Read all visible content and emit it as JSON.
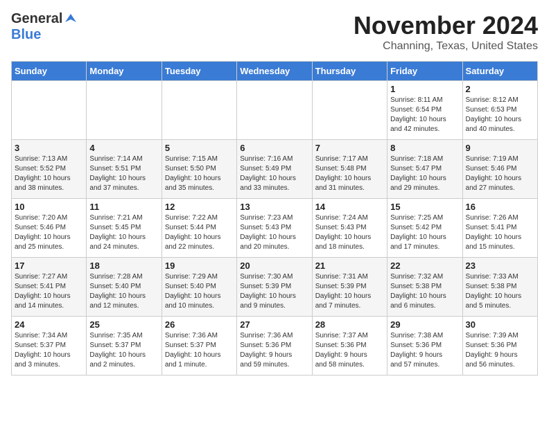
{
  "header": {
    "logo_general": "General",
    "logo_blue": "Blue",
    "month": "November 2024",
    "location": "Channing, Texas, United States"
  },
  "weekdays": [
    "Sunday",
    "Monday",
    "Tuesday",
    "Wednesday",
    "Thursday",
    "Friday",
    "Saturday"
  ],
  "weeks": [
    [
      {
        "day": "",
        "info": ""
      },
      {
        "day": "",
        "info": ""
      },
      {
        "day": "",
        "info": ""
      },
      {
        "day": "",
        "info": ""
      },
      {
        "day": "",
        "info": ""
      },
      {
        "day": "1",
        "info": "Sunrise: 8:11 AM\nSunset: 6:54 PM\nDaylight: 10 hours\nand 42 minutes."
      },
      {
        "day": "2",
        "info": "Sunrise: 8:12 AM\nSunset: 6:53 PM\nDaylight: 10 hours\nand 40 minutes."
      }
    ],
    [
      {
        "day": "3",
        "info": "Sunrise: 7:13 AM\nSunset: 5:52 PM\nDaylight: 10 hours\nand 38 minutes."
      },
      {
        "day": "4",
        "info": "Sunrise: 7:14 AM\nSunset: 5:51 PM\nDaylight: 10 hours\nand 37 minutes."
      },
      {
        "day": "5",
        "info": "Sunrise: 7:15 AM\nSunset: 5:50 PM\nDaylight: 10 hours\nand 35 minutes."
      },
      {
        "day": "6",
        "info": "Sunrise: 7:16 AM\nSunset: 5:49 PM\nDaylight: 10 hours\nand 33 minutes."
      },
      {
        "day": "7",
        "info": "Sunrise: 7:17 AM\nSunset: 5:48 PM\nDaylight: 10 hours\nand 31 minutes."
      },
      {
        "day": "8",
        "info": "Sunrise: 7:18 AM\nSunset: 5:47 PM\nDaylight: 10 hours\nand 29 minutes."
      },
      {
        "day": "9",
        "info": "Sunrise: 7:19 AM\nSunset: 5:46 PM\nDaylight: 10 hours\nand 27 minutes."
      }
    ],
    [
      {
        "day": "10",
        "info": "Sunrise: 7:20 AM\nSunset: 5:46 PM\nDaylight: 10 hours\nand 25 minutes."
      },
      {
        "day": "11",
        "info": "Sunrise: 7:21 AM\nSunset: 5:45 PM\nDaylight: 10 hours\nand 24 minutes."
      },
      {
        "day": "12",
        "info": "Sunrise: 7:22 AM\nSunset: 5:44 PM\nDaylight: 10 hours\nand 22 minutes."
      },
      {
        "day": "13",
        "info": "Sunrise: 7:23 AM\nSunset: 5:43 PM\nDaylight: 10 hours\nand 20 minutes."
      },
      {
        "day": "14",
        "info": "Sunrise: 7:24 AM\nSunset: 5:43 PM\nDaylight: 10 hours\nand 18 minutes."
      },
      {
        "day": "15",
        "info": "Sunrise: 7:25 AM\nSunset: 5:42 PM\nDaylight: 10 hours\nand 17 minutes."
      },
      {
        "day": "16",
        "info": "Sunrise: 7:26 AM\nSunset: 5:41 PM\nDaylight: 10 hours\nand 15 minutes."
      }
    ],
    [
      {
        "day": "17",
        "info": "Sunrise: 7:27 AM\nSunset: 5:41 PM\nDaylight: 10 hours\nand 14 minutes."
      },
      {
        "day": "18",
        "info": "Sunrise: 7:28 AM\nSunset: 5:40 PM\nDaylight: 10 hours\nand 12 minutes."
      },
      {
        "day": "19",
        "info": "Sunrise: 7:29 AM\nSunset: 5:40 PM\nDaylight: 10 hours\nand 10 minutes."
      },
      {
        "day": "20",
        "info": "Sunrise: 7:30 AM\nSunset: 5:39 PM\nDaylight: 10 hours\nand 9 minutes."
      },
      {
        "day": "21",
        "info": "Sunrise: 7:31 AM\nSunset: 5:39 PM\nDaylight: 10 hours\nand 7 minutes."
      },
      {
        "day": "22",
        "info": "Sunrise: 7:32 AM\nSunset: 5:38 PM\nDaylight: 10 hours\nand 6 minutes."
      },
      {
        "day": "23",
        "info": "Sunrise: 7:33 AM\nSunset: 5:38 PM\nDaylight: 10 hours\nand 5 minutes."
      }
    ],
    [
      {
        "day": "24",
        "info": "Sunrise: 7:34 AM\nSunset: 5:37 PM\nDaylight: 10 hours\nand 3 minutes."
      },
      {
        "day": "25",
        "info": "Sunrise: 7:35 AM\nSunset: 5:37 PM\nDaylight: 10 hours\nand 2 minutes."
      },
      {
        "day": "26",
        "info": "Sunrise: 7:36 AM\nSunset: 5:37 PM\nDaylight: 10 hours\nand 1 minute."
      },
      {
        "day": "27",
        "info": "Sunrise: 7:36 AM\nSunset: 5:36 PM\nDaylight: 9 hours\nand 59 minutes."
      },
      {
        "day": "28",
        "info": "Sunrise: 7:37 AM\nSunset: 5:36 PM\nDaylight: 9 hours\nand 58 minutes."
      },
      {
        "day": "29",
        "info": "Sunrise: 7:38 AM\nSunset: 5:36 PM\nDaylight: 9 hours\nand 57 minutes."
      },
      {
        "day": "30",
        "info": "Sunrise: 7:39 AM\nSunset: 5:36 PM\nDaylight: 9 hours\nand 56 minutes."
      }
    ]
  ]
}
